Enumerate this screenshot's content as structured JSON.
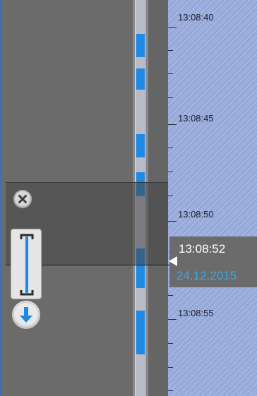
{
  "timeline": {
    "labels": [
      {
        "text": "13:08:40"
      },
      {
        "text": "13:08:45"
      },
      {
        "text": "13:08:50"
      },
      {
        "text": "13:08:55"
      }
    ],
    "cursor": {
      "time": "13:08:52",
      "date": "24.12.2015"
    },
    "colors": {
      "scale_background": "#9aaee0",
      "recorded_segment": "#1e8ae6",
      "date_text": "#39a7ea"
    }
  },
  "controls": {
    "close_icon": "close-icon",
    "range_icon": "bracket-range-icon",
    "download_icon": "download-arrow-icon"
  }
}
